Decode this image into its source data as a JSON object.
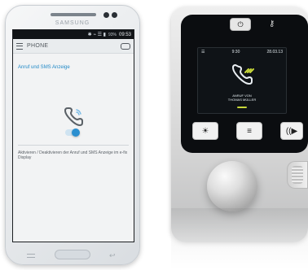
{
  "phone": {
    "brand": "SAMSUNG",
    "statusbar": {
      "icons": "✱ ⌁ ☰ ▮",
      "battery": "93%",
      "time": "09:53"
    },
    "appbar": {
      "title": "PHONE"
    },
    "settings": {
      "section_title": "Anruf und SMS Anzeige",
      "toggle_state": "on",
      "description": "Aktivieren / Deaktivieren der Anruf und SMS Anzeige im e-fix Display"
    },
    "colors": {
      "accent": "#1f88c6",
      "toggle_on": "#2b8fd0"
    }
  },
  "device": {
    "display": {
      "status_left": "☰",
      "time": "9:30",
      "date": "28.03.13",
      "caller_line_1": "ANRUF VON",
      "caller_line_2": "THOMAS MÜLLER"
    },
    "buttons": {
      "power_symbol": "⏻",
      "key_symbol": "⚷",
      "softkey_left_symbol": "☀",
      "softkey_center_symbol": "≡",
      "softkey_right_symbol": "((▶"
    },
    "colors": {
      "display_accent": "#c8d83a"
    },
    "icons": {
      "call": "incoming-call-icon",
      "power": "power-icon",
      "key": "key-icon",
      "brightness": "brightness-icon",
      "menu": "menu-icon",
      "audio": "speaker-icon"
    }
  }
}
